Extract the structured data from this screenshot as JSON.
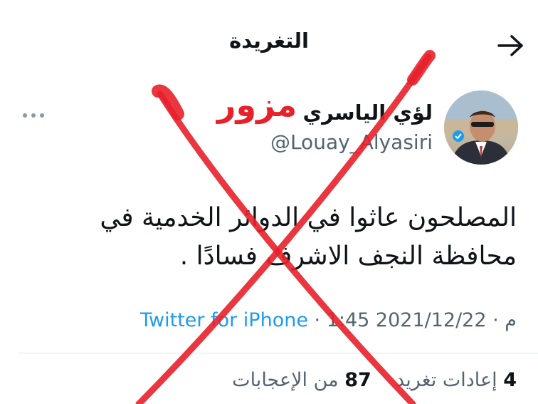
{
  "header": {
    "title": "التغريدة",
    "back_icon": "arrow-right-icon"
  },
  "author": {
    "name": "لؤي الياسري",
    "handle": "@Louay_Alyasiri",
    "verified_icon": "verified-badge-icon"
  },
  "tweet": {
    "line1": "المصلحون عاثوا في الدوائر الخدمية في",
    "line2": "محافظة النجف الاشرف فسادًا ."
  },
  "meta": {
    "date": "2021/12/22",
    "sep1": " · ",
    "time": "1:45 م",
    "sep2": " · ",
    "source": "Twitter for iPhone"
  },
  "stats": {
    "retweets_count": "4",
    "retweets_label": "إعادات تغريد",
    "likes_count": "87",
    "likes_label": "من الإعجابات"
  },
  "overlay": {
    "stamp": "مزور",
    "stamp_color": "#e8202a"
  },
  "colors": {
    "link": "#1d9bf0",
    "secondary_text": "#536471",
    "divider": "#dfe4e7"
  }
}
